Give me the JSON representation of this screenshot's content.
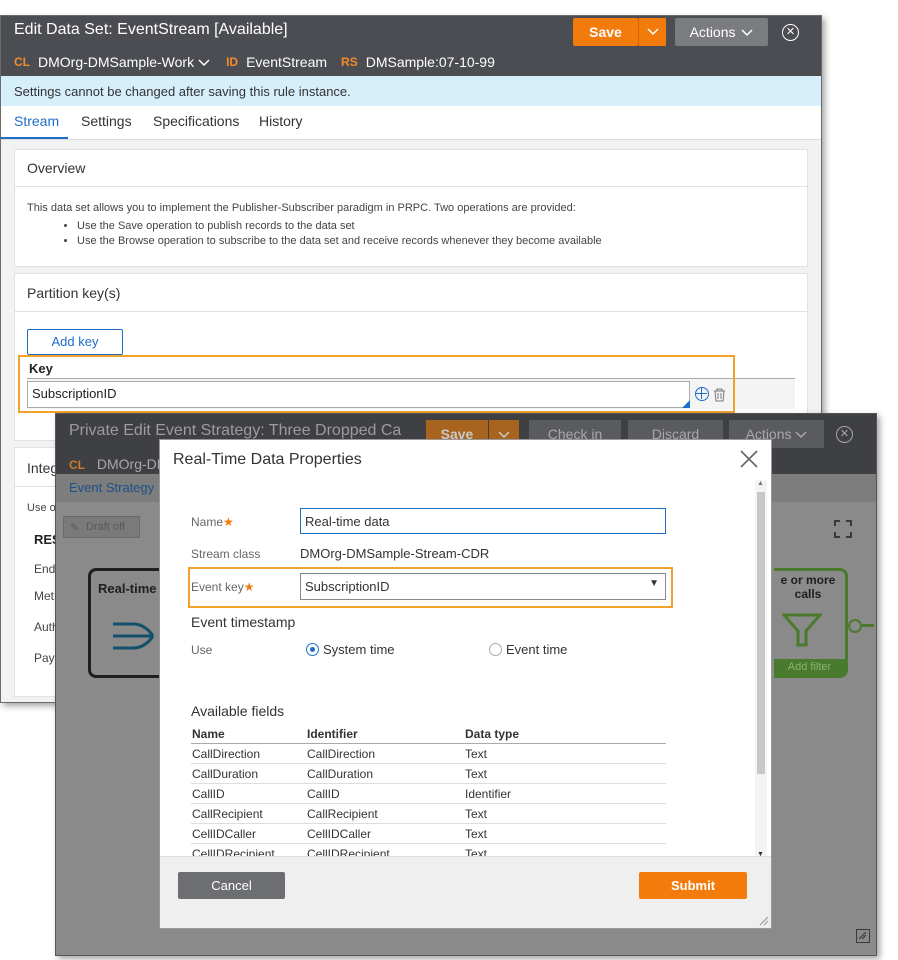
{
  "win1": {
    "title": "Edit Data Set: EventStream [Available]",
    "context": [
      {
        "tag": "CL",
        "value": "DMOrg-DMSample-Work"
      },
      {
        "tag": "ID",
        "value": "EventStream"
      },
      {
        "tag": "RS",
        "value": "DMSample:07-10-99"
      }
    ],
    "save_label": "Save",
    "actions_label": "Actions",
    "info_message": "Settings cannot be changed after saving this rule instance.",
    "tabs": [
      "Stream",
      "Settings",
      "Specifications",
      "History"
    ],
    "overview": {
      "title": "Overview",
      "text": "This data set allows you to implement the Publisher-Subscriber paradigm in PRPC. Two operations are provided:",
      "bullets": [
        "Use the Save operation to publish records to the data set",
        "Use the Browse operation to subscribe to the data set and receive records whenever they become available"
      ]
    },
    "partition": {
      "title": "Partition key(s)",
      "add_key_label": "Add key",
      "key_header": "Key",
      "key_value": "SubscriptionID"
    },
    "integration": {
      "title": "Integ",
      "use_text": "Use o",
      "rest_label": "RES",
      "rows": [
        "Endp",
        "Met",
        "Auth",
        "Payl"
      ]
    }
  },
  "win2": {
    "title": "Private Edit Event Strategy: Three Dropped Ca",
    "save_label": "Save",
    "checkin_label": "Check in",
    "discard_label": "Discard",
    "actions_label": "Actions",
    "class_tag": "CL",
    "class_value": "DMOrg-DM",
    "tab_label": "Event Strategy",
    "draft_label": "Draft off",
    "shape_left_label": "Real-time",
    "shape_right_label": "e or more calls",
    "add_filter_label": "Add filter"
  },
  "modal": {
    "title": "Real-Time Data Properties",
    "name_label": "Name",
    "name_value": "Real-time data",
    "stream_class_label": "Stream class",
    "stream_class_value": "DMOrg-DMSample-Stream-CDR",
    "event_key_label": "Event key",
    "event_key_value": "SubscriptionID",
    "timestamp_title": "Event timestamp",
    "use_label": "Use",
    "radio_system": "System time",
    "radio_event": "Event time",
    "available_fields_title": "Available fields",
    "columns": [
      "Name",
      "Identifier",
      "Data type"
    ],
    "rows": [
      [
        "CallDirection",
        "CallDirection",
        "Text"
      ],
      [
        "CallDuration",
        "CallDuration",
        "Text"
      ],
      [
        "CallID",
        "CallID",
        "Identifier"
      ],
      [
        "CallRecipient",
        "CallRecipient",
        "Text"
      ],
      [
        "CellIDCaller",
        "CellIDCaller",
        "Text"
      ],
      [
        "CellIDRecipient",
        "CellIDRecipient",
        "Text"
      ]
    ],
    "cancel_label": "Cancel",
    "submit_label": "Submit"
  },
  "colors": {
    "accent_orange": "#f27b0c",
    "highlight_orange": "#f2a22b",
    "link_blue": "#1e6ec8",
    "header_dark": "#4b4d52"
  }
}
